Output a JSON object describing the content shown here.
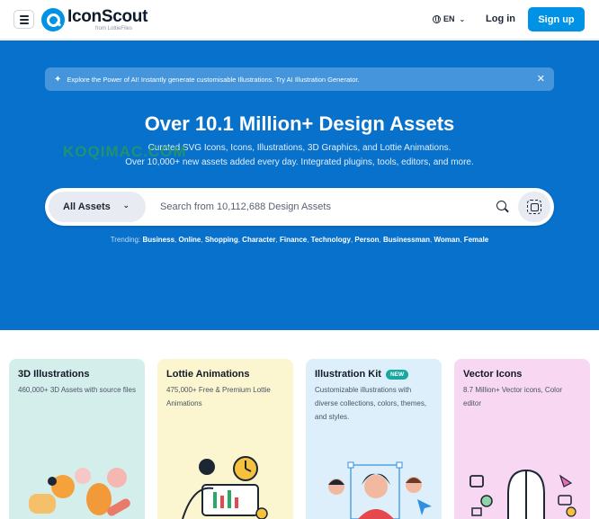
{
  "header": {
    "brand": "IconScout",
    "brand_sub": "from LottieFiles",
    "language": "EN",
    "login_label": "Log in",
    "signup_label": "Sign up"
  },
  "hero": {
    "announcement": "Explore the Power of AI! Instantly generate customisable Illustrations. Try AI Illustration Generator.",
    "title": "Over 10.1 Million+ Design Assets",
    "subtitle_line1": "Curated SVG Icons, Icons, Illustrations, 3D Graphics, and Lottie Animations.",
    "subtitle_line2": "Over 10,000+ new assets added every day. Integrated plugins, tools, editors, and more.",
    "watermark": "KOQIMAC.COM",
    "search": {
      "category": "All Assets",
      "placeholder": "Search from 10,112,688 Design Assets"
    },
    "trending_label": "Trending:",
    "trending": [
      "Business",
      "Online",
      "Shopping",
      "Character",
      "Finance",
      "Technology",
      "Person",
      "Businessman",
      "Woman",
      "Female"
    ]
  },
  "cards": [
    {
      "title": "3D Illustrations",
      "desc": "460,000+ 3D Assets with source files",
      "color": "#d4eeec"
    },
    {
      "title": "Lottie Animations",
      "desc": "475,000+ Free & Premium Lottie Animations",
      "color": "#fbf6cf"
    },
    {
      "title": "Illustration Kit",
      "badge": "NEW",
      "desc": "Customizable illustrations with diverse collections, colors, themes, and styles.",
      "color": "#ddeffa"
    },
    {
      "title": "Vector Icons",
      "desc": "8.7 Million+ Vector icons, Color editor",
      "color": "#f7d7f2"
    }
  ],
  "colors": {
    "brand_blue": "#0092e4",
    "hero_bg": "#0871cc"
  }
}
